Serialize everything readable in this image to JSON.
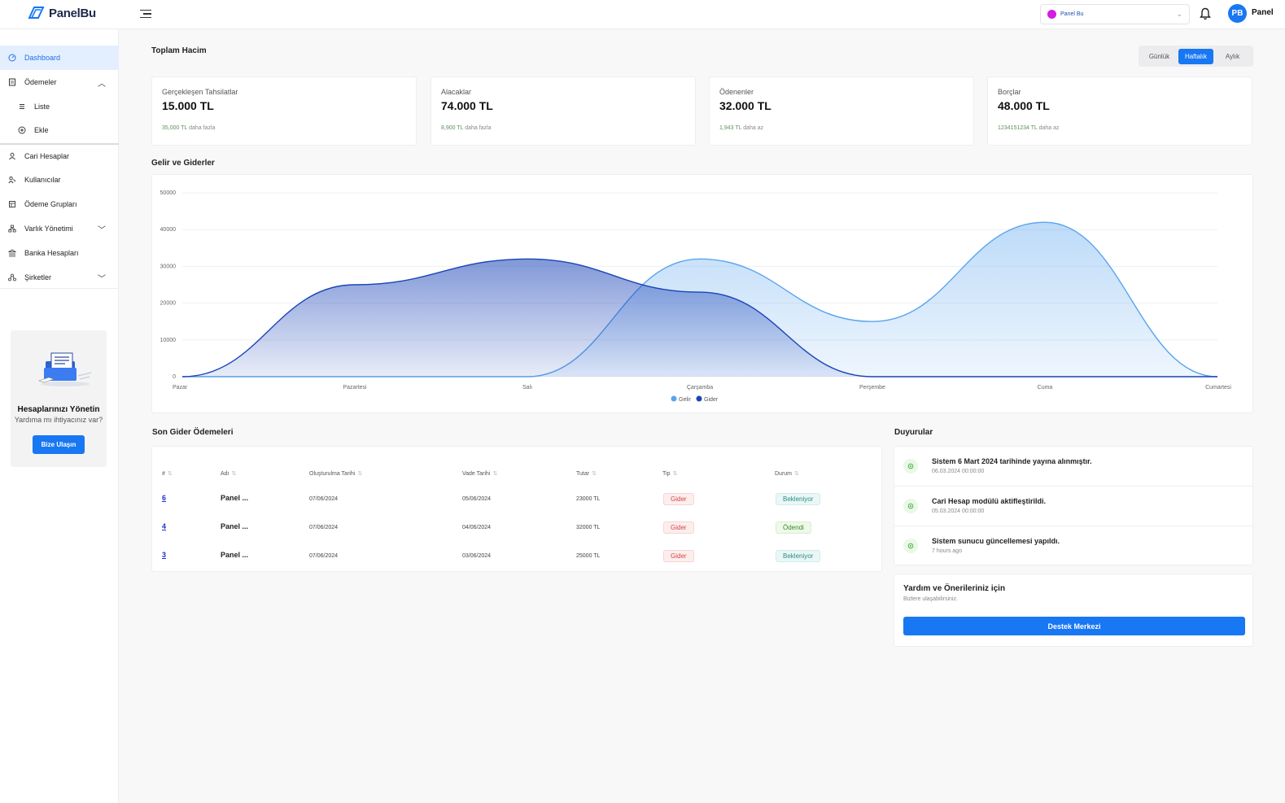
{
  "app": {
    "logo_text": "PanelBu"
  },
  "topbar": {
    "company_select": "Panel Bu",
    "avatar_initials": "PB",
    "user_name": "Panel"
  },
  "sidebar": {
    "items": [
      {
        "label": "Dashboard",
        "icon": "dashboard-icon"
      },
      {
        "label": "Ödemeler",
        "icon": "receipt-icon"
      },
      {
        "label": "Liste",
        "icon": "list-icon"
      },
      {
        "label": "Ekle",
        "icon": "plus-circle-icon"
      },
      {
        "label": "Cari Hesaplar",
        "icon": "user-icon"
      },
      {
        "label": "Kullanıcılar",
        "icon": "users-icon"
      },
      {
        "label": "Ödeme Grupları",
        "icon": "group-icon"
      },
      {
        "label": "Varlık Yönetimi",
        "icon": "hierarchy-icon"
      },
      {
        "label": "Banka Hesapları",
        "icon": "bank-icon"
      },
      {
        "label": "Şirketler",
        "icon": "company-icon"
      }
    ],
    "promo": {
      "title": "Hesaplarınızı Yönetin",
      "subtitle": "Yardıma mı ihtiyacınız var?",
      "button": "Bize Ulaşın"
    }
  },
  "overview": {
    "title": "Toplam Hacim",
    "periods": [
      "Günlük",
      "Haftalık",
      "Aylık"
    ],
    "selected_period": "Haftalık",
    "cards": [
      {
        "label": "Gerçekleşen Tahsilatlar",
        "value": "15.000 TL",
        "note_value": "35,000 TL",
        "note_text": "daha fazla"
      },
      {
        "label": "Alacaklar",
        "value": "74.000 TL",
        "note_value": "8,900 TL",
        "note_text": "daha fazla"
      },
      {
        "label": "Ödenenler",
        "value": "32.000 TL",
        "note_value": "1,943 TL",
        "note_text": "daha az"
      },
      {
        "label": "Borçlar",
        "value": "48.000 TL",
        "note_value": "1234151234 TL",
        "note_text": "daha az"
      }
    ]
  },
  "chart_section": {
    "title": "Gelir ve Giderler"
  },
  "chart_data": {
    "type": "area",
    "title": "",
    "categories": [
      "Pazar",
      "Pazartesi",
      "Salı",
      "Çarşamba",
      "Perşembe",
      "Cuma",
      "Cumartesi"
    ],
    "ylim": [
      0,
      50000
    ],
    "yticks": [
      0,
      10000,
      20000,
      30000,
      40000,
      50000
    ],
    "legend_position": "bottom",
    "grid": true,
    "series": [
      {
        "name": "Gelir",
        "color": "#5aa4ee",
        "values": [
          0,
          0,
          0,
          32000,
          15000,
          42000,
          0
        ]
      },
      {
        "name": "Gider",
        "color": "#1a44b8",
        "values": [
          0,
          25000,
          32000,
          23000,
          0,
          0,
          0
        ]
      }
    ]
  },
  "payments": {
    "title": "Son Gider Ödemeleri",
    "columns": [
      "#",
      "Adı",
      "Oluşturulma Tarihi",
      "Vade Tarihi",
      "Tutar",
      "Tip",
      "Durum"
    ],
    "rows": [
      {
        "id": "6",
        "name": "Panel ...",
        "created": "07/06/2024",
        "due": "05/06/2024",
        "amount": "23000 TL",
        "type": "Gider",
        "status": "Bekleniyor"
      },
      {
        "id": "4",
        "name": "Panel ...",
        "created": "07/06/2024",
        "due": "04/06/2024",
        "amount": "32000 TL",
        "type": "Gider",
        "status": "Ödendi"
      },
      {
        "id": "3",
        "name": "Panel ...",
        "created": "07/06/2024",
        "due": "03/06/2024",
        "amount": "25000 TL",
        "type": "Gider",
        "status": "Bekleniyor"
      }
    ]
  },
  "announcements": {
    "title": "Duyurular",
    "items": [
      {
        "text": "Sistem 6 Mart 2024 tarihinde yayına alınmıştır.",
        "date": "06.03.2024 00:00:00"
      },
      {
        "text": "Cari Hesap modülü aktifleştirildi.",
        "date": "05.03.2024 00:00:00"
      },
      {
        "text": "Sistem sunucu güncellemesi yapıldı.",
        "date": "7 hours ago"
      }
    ]
  },
  "help": {
    "title": "Yardım ve Önerileriniz için",
    "subtitle": "Bizlere ulaşabilirsiniz.",
    "button": "Destek Merkezi"
  }
}
